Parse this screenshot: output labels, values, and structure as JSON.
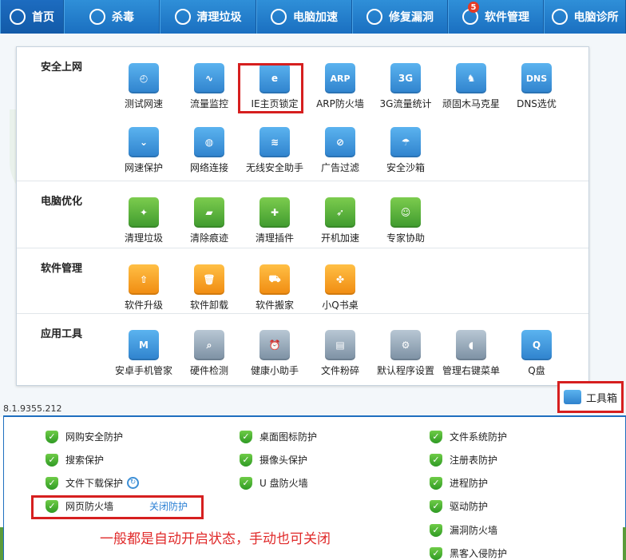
{
  "nav": [
    {
      "label": "首页",
      "icon": "monitor-icon"
    },
    {
      "label": "杀毒",
      "icon": "antivirus-icon"
    },
    {
      "label": "清理垃圾",
      "icon": "broom-icon"
    },
    {
      "label": "电脑加速",
      "icon": "rocket-icon"
    },
    {
      "label": "修复漏洞",
      "icon": "patch-icon"
    },
    {
      "label": "软件管理",
      "icon": "software-icon",
      "badge": "5"
    },
    {
      "label": "电脑诊所",
      "icon": "stethoscope-icon"
    }
  ],
  "sections": [
    {
      "title": "安全上网",
      "tools": [
        {
          "label": "测试网速",
          "icon": "speedometer-icon",
          "glyph": "◴",
          "color": "blue"
        },
        {
          "label": "流量监控",
          "icon": "traffic-chart-icon",
          "glyph": "∿",
          "color": "blue"
        },
        {
          "label": "IE主页锁定",
          "icon": "ie-lock-icon",
          "glyph": "e",
          "color": "blue"
        },
        {
          "label": "ARP防火墙",
          "icon": "arp-icon",
          "glyph": "ARP",
          "color": "blue"
        },
        {
          "label": "3G流量统计",
          "icon": "3g-icon",
          "glyph": "3G",
          "color": "blue"
        },
        {
          "label": "顽固木马克星",
          "icon": "chess-knight-icon",
          "glyph": "♞",
          "color": "blue"
        },
        {
          "label": "DNS选优",
          "icon": "dns-icon",
          "glyph": "DNS",
          "color": "blue"
        },
        {
          "label": "网速保护",
          "icon": "chevron-shield-icon",
          "glyph": "⌄",
          "color": "blue"
        },
        {
          "label": "网络连接",
          "icon": "globe-icon",
          "glyph": "◍",
          "color": "blue"
        },
        {
          "label": "无线安全助手",
          "icon": "wifi-icon",
          "glyph": "≋",
          "color": "blue"
        },
        {
          "label": "广告过滤",
          "icon": "ad-block-icon",
          "glyph": "⊘",
          "color": "blue"
        },
        {
          "label": "安全沙箱",
          "icon": "sandbox-icon",
          "glyph": "☂",
          "color": "blue"
        }
      ]
    },
    {
      "title": "电脑优化",
      "tools": [
        {
          "label": "清理垃圾",
          "icon": "broom-icon",
          "glyph": "✦",
          "color": "green"
        },
        {
          "label": "清除痕迹",
          "icon": "eraser-icon",
          "glyph": "▰",
          "color": "green"
        },
        {
          "label": "清理插件",
          "icon": "puzzle-icon",
          "glyph": "✚",
          "color": "green"
        },
        {
          "label": "开机加速",
          "icon": "rocket-icon",
          "glyph": "➶",
          "color": "green"
        },
        {
          "label": "专家协助",
          "icon": "expert-icon",
          "glyph": "☺",
          "color": "green"
        }
      ]
    },
    {
      "title": "软件管理",
      "tools": [
        {
          "label": "软件升级",
          "icon": "upgrade-icon",
          "glyph": "⇧",
          "color": "orange"
        },
        {
          "label": "软件卸载",
          "icon": "trash-icon",
          "glyph": "🗑",
          "color": "orange"
        },
        {
          "label": "软件搬家",
          "icon": "truck-icon",
          "glyph": "⛟",
          "color": "orange"
        },
        {
          "label": "小Q书桌",
          "icon": "clover-icon",
          "glyph": "✤",
          "color": "orange"
        }
      ]
    },
    {
      "title": "应用工具",
      "tools": [
        {
          "label": "安卓手机管家",
          "icon": "android-shield-icon",
          "glyph": "M",
          "color": "blue"
        },
        {
          "label": "硬件检测",
          "icon": "hardware-icon",
          "glyph": "⌕",
          "color": "gray"
        },
        {
          "label": "健康小助手",
          "icon": "alarm-clock-icon",
          "glyph": "⏰",
          "color": "gray"
        },
        {
          "label": "文件粉碎",
          "icon": "shredder-icon",
          "glyph": "▤",
          "color": "gray"
        },
        {
          "label": "默认程序设置",
          "icon": "gear-icon",
          "glyph": "⚙",
          "color": "gray"
        },
        {
          "label": "管理右键菜单",
          "icon": "mouse-icon",
          "glyph": "◖",
          "color": "gray"
        },
        {
          "label": "Q盘",
          "icon": "q-disk-icon",
          "glyph": "Q",
          "color": "blue"
        }
      ]
    }
  ],
  "version": "8.1.9355.212",
  "toolbox": {
    "label": "工具箱",
    "icon": "toolbox-icon"
  },
  "protections": {
    "col1": [
      "网购安全防护",
      "搜索保护",
      "文件下载保护"
    ],
    "web_firewall": {
      "label": "网页防火墙",
      "action": "关闭防护"
    },
    "col2": [
      "桌面图标防护",
      "摄像头保护",
      "U 盘防火墙"
    ],
    "col3": [
      "文件系统防护",
      "注册表防护",
      "进程防护",
      "驱动防护",
      "漏洞防火墙",
      "黑客入侵防护"
    ]
  },
  "note": "一般都是自动开启状态，手动也可关闭"
}
